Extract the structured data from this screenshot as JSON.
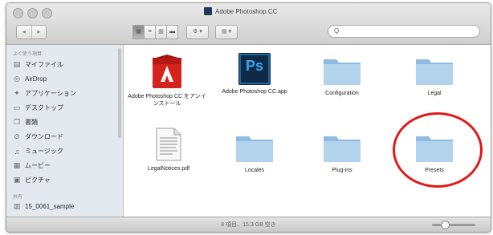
{
  "window": {
    "title": "Adobe Photoshop CC",
    "title_icon": "photoshop-icon"
  },
  "toolbar": {
    "back": "◂",
    "forward": "▸",
    "view_icons": [
      "icon-view-icon",
      "list-view-icon",
      "column-view-icon",
      "coverflow-view-icon"
    ],
    "action_label": "⚙ ▾",
    "arrange_label": "▤ ▾",
    "search_placeholder": "Q"
  },
  "sidebar": {
    "favorites_header": "よく使う項目",
    "items": [
      {
        "label": "マイファイル",
        "icon": "all-files-icon"
      },
      {
        "label": "AirDrop",
        "icon": "airdrop-icon"
      },
      {
        "label": "アプリケーション",
        "icon": "applications-icon"
      },
      {
        "label": "デスクトップ",
        "icon": "desktop-icon"
      },
      {
        "label": "書類",
        "icon": "documents-icon"
      },
      {
        "label": "ダウンロード",
        "icon": "downloads-icon"
      },
      {
        "label": "ミュージック",
        "icon": "music-icon"
      },
      {
        "label": "ムービー",
        "icon": "movies-icon"
      },
      {
        "label": "ピクチャ",
        "icon": "pictures-icon"
      }
    ],
    "devices_header": "共有",
    "device_item": "15_0061_sample"
  },
  "files": [
    {
      "name": "Adobe Photoshop CC をアンインストール",
      "kind": "uninstaller",
      "color": "#d4221c"
    },
    {
      "name": "Adobe Photoshop CC.app",
      "kind": "app",
      "color": "#0f2a47"
    },
    {
      "name": "Configuration",
      "kind": "folder"
    },
    {
      "name": "Legal",
      "kind": "folder"
    },
    {
      "name": "LegalNotices.pdf",
      "kind": "document"
    },
    {
      "name": "Locales",
      "kind": "folder"
    },
    {
      "name": "Plug-ins",
      "kind": "folder"
    },
    {
      "name": "Presets",
      "kind": "folder"
    }
  ],
  "app_icon_text": "Ps",
  "status": {
    "text": "8 項目、15.3 GB 空き"
  },
  "colors": {
    "highlight": "#e11a1a",
    "folder": "#a8cbe6"
  }
}
